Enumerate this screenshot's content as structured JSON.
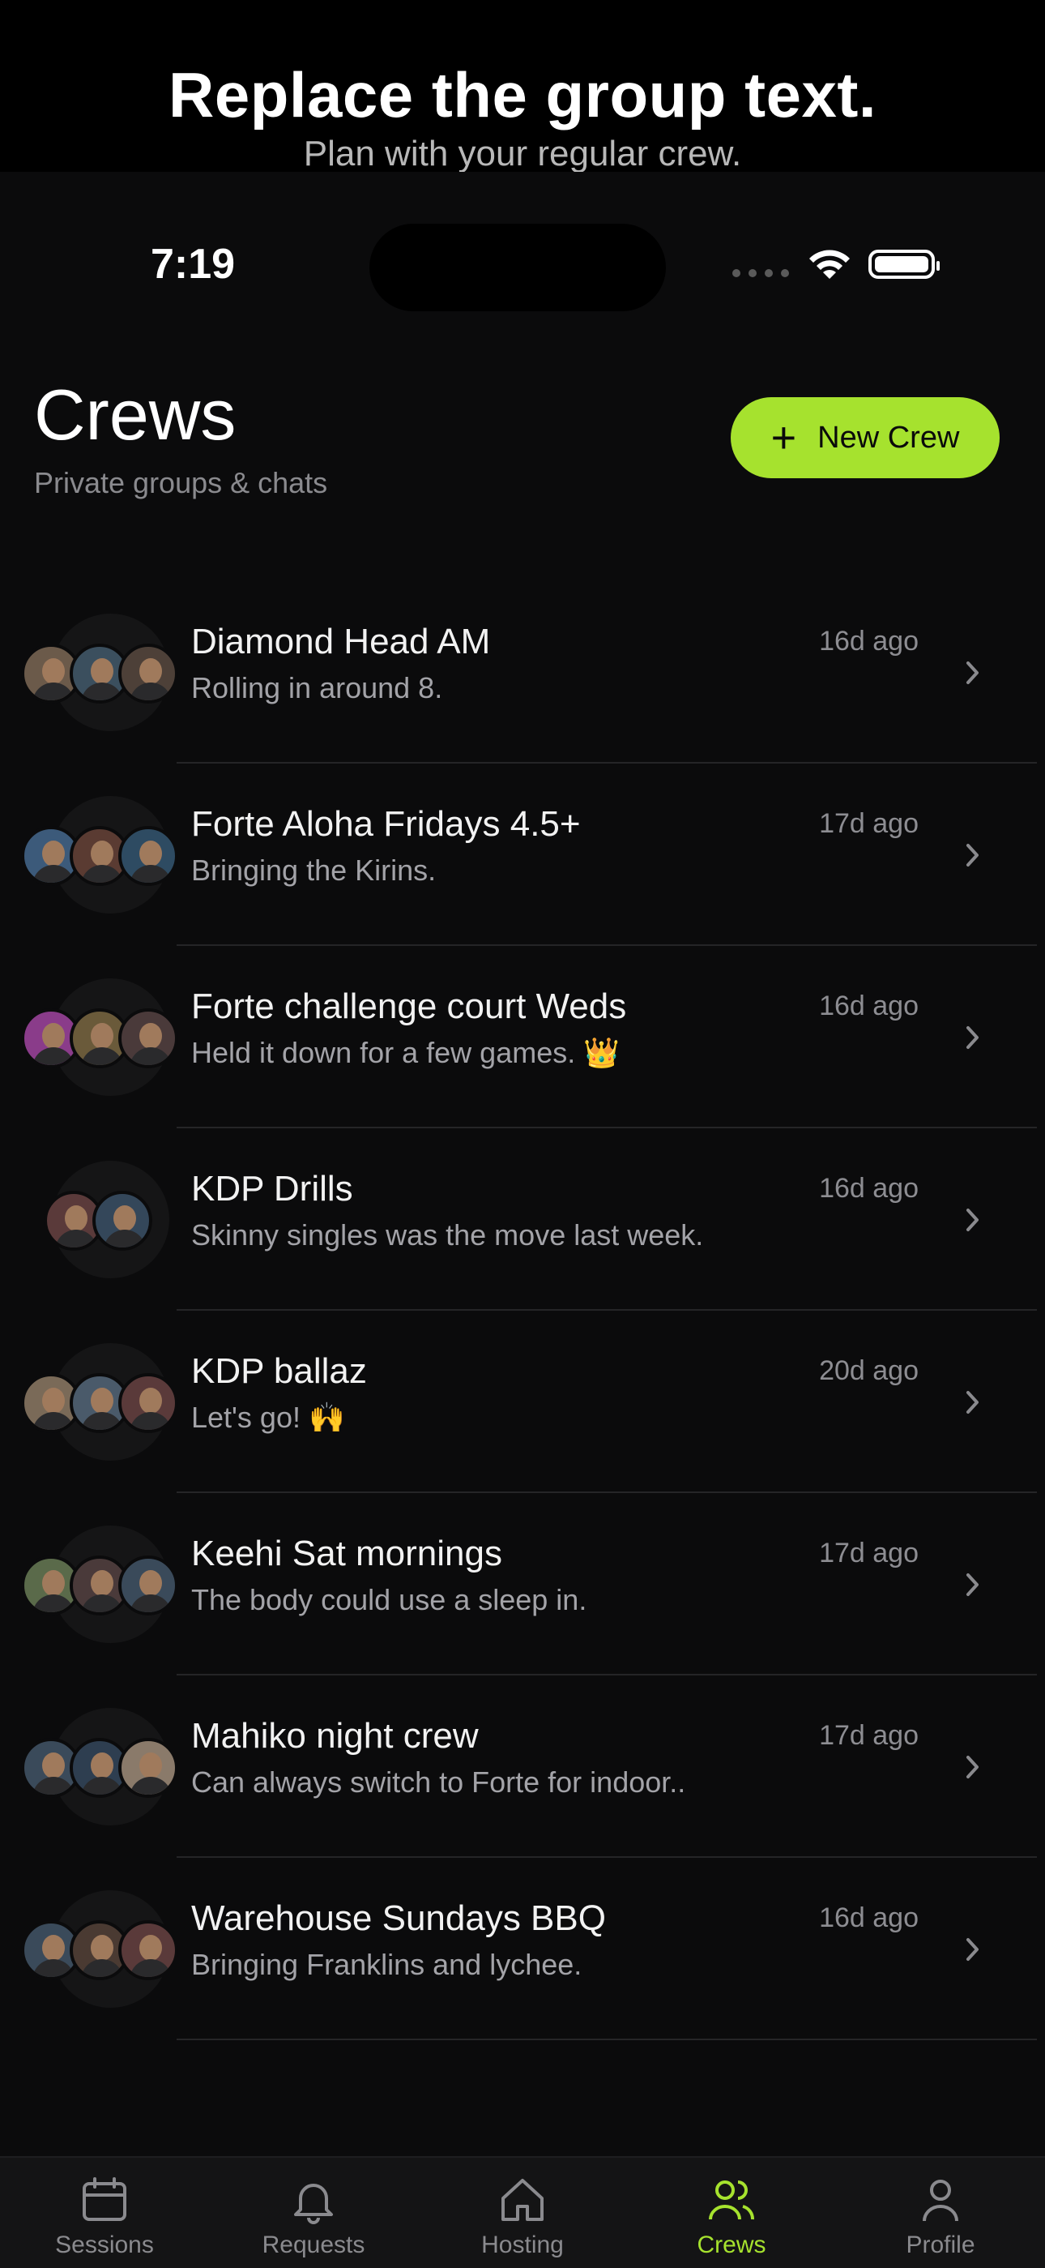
{
  "promo": {
    "title": "Replace the group text.",
    "subtitle": "Plan with your regular crew."
  },
  "status_bar": {
    "time": "7:19"
  },
  "header": {
    "title": "Crews",
    "subtitle": "Private groups & chats",
    "new_button_label": "New Crew"
  },
  "crews": [
    {
      "name": "Diamond Head AM",
      "message": "Rolling in around 8.",
      "time": "16d ago",
      "avatar_colors": [
        "#6b5a4a",
        "#3b4f5e",
        "#4d4038"
      ]
    },
    {
      "name": "Forte Aloha Fridays 4.5+",
      "message": "Bringing the Kirins.",
      "time": "17d ago",
      "avatar_colors": [
        "#3c5a7a",
        "#5a3b32",
        "#2e4b62"
      ]
    },
    {
      "name": "Forte challenge court Weds",
      "message": "Held it down for a few games. 👑",
      "time": "16d ago",
      "avatar_colors": [
        "#8a3c8a",
        "#6a5a3a",
        "#4a3a3a"
      ]
    },
    {
      "name": "KDP Drills",
      "message": "Skinny singles was the move last week.",
      "time": "16d ago",
      "avatar_colors": [
        "#5a3a3a",
        "#34475a"
      ]
    },
    {
      "name": "KDP ballaz",
      "message": "Let's go! 🙌",
      "time": "20d ago",
      "avatar_colors": [
        "#7a6a58",
        "#4a5a6a",
        "#5a3a3a"
      ]
    },
    {
      "name": "Keehi Sat mornings",
      "message": "The body could use a sleep in.",
      "time": "17d ago",
      "avatar_colors": [
        "#5a6a4a",
        "#4a3a3a",
        "#3a4a5a"
      ]
    },
    {
      "name": "Mahiko night crew",
      "message": "Can always switch to Forte for indoor..",
      "time": "17d ago",
      "avatar_colors": [
        "#3a4a5a",
        "#2e3e50",
        "#8a7a6a"
      ]
    },
    {
      "name": "Warehouse Sundays BBQ",
      "message": "Bringing Franklins and lychee.",
      "time": "16d ago",
      "avatar_colors": [
        "#3a4a5a",
        "#4a3a32",
        "#5a3a3a"
      ]
    }
  ],
  "tabs": [
    {
      "label": "Sessions",
      "icon": "calendar-icon"
    },
    {
      "label": "Requests",
      "icon": "bell-icon"
    },
    {
      "label": "Hosting",
      "icon": "home-icon"
    },
    {
      "label": "Crews",
      "icon": "people-icon",
      "active": true
    },
    {
      "label": "Profile",
      "icon": "person-icon"
    }
  ],
  "colors": {
    "accent": "#a6e22e",
    "background": "#0b0b0c"
  }
}
